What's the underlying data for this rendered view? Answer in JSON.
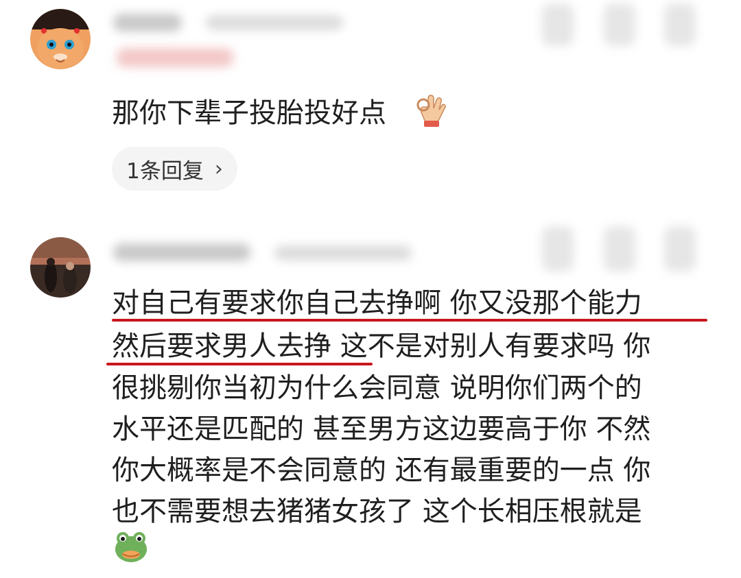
{
  "comments": [
    {
      "text": "那你下辈子投胎投好点",
      "reply_label": "1条回复",
      "reply_chevron": "›"
    },
    {
      "lines": [
        "对自己有要求你自己去挣啊   你又没那个能力",
        "然后要求男人去挣  这不是对别人有要求吗  你",
        "很挑剔你当初为什么会同意   说明你们两个的",
        "水平还是匹配的  甚至男方这边要高于你  不然",
        "你大概率是不会同意的  还有最重要的一点  你",
        "也不需要想去猪猪女孩了    这个长相压根就是"
      ]
    }
  ],
  "icons": {
    "ok_hand": "ok-hand-icon",
    "frog_face": "frog-face-icon"
  },
  "colors": {
    "underline": "#c8161d",
    "pill_bg": "#f4f4f4"
  }
}
